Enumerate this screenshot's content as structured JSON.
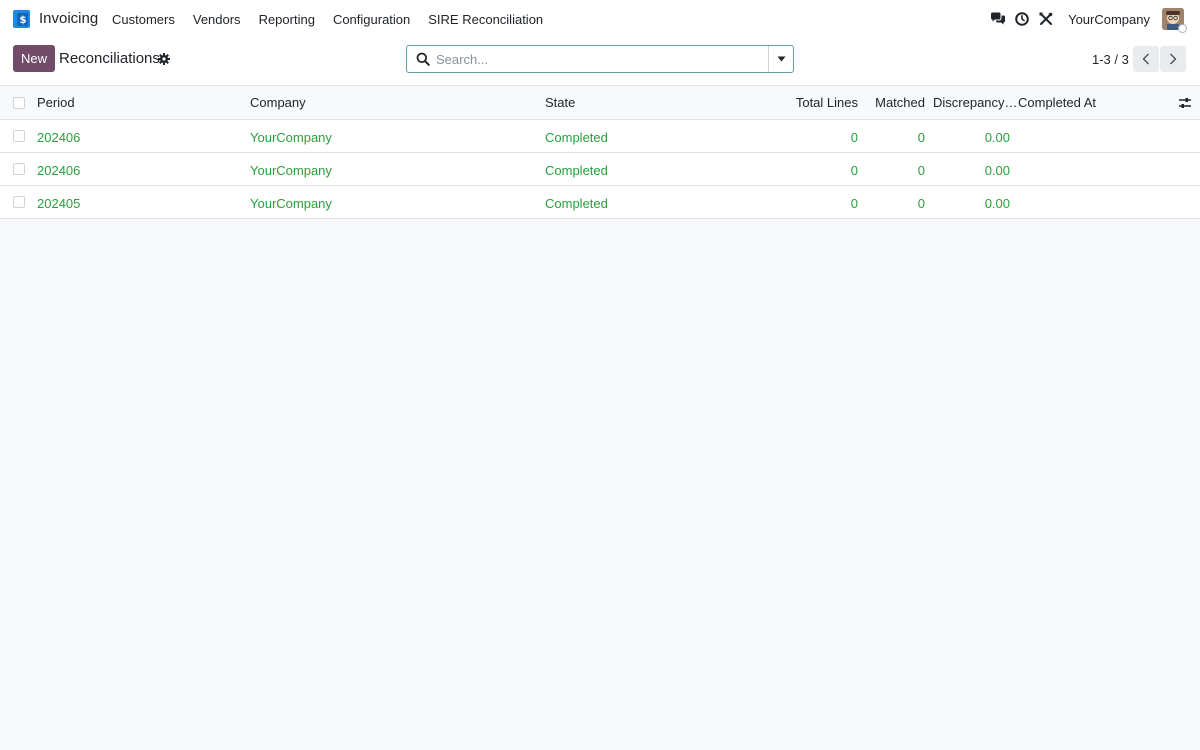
{
  "navbar": {
    "app_name": "Invoicing",
    "menu": [
      "Customers",
      "Vendors",
      "Reporting",
      "Configuration",
      "SIRE Reconciliation"
    ],
    "company": "YourCompany",
    "icons": [
      "chat-icon",
      "clock-icon",
      "tools-icon"
    ]
  },
  "control_panel": {
    "new_label": "New",
    "title": "Reconciliations",
    "search_placeholder": "Search...",
    "pager": "1-3 / 3"
  },
  "list": {
    "columns": {
      "period": "Period",
      "company": "Company",
      "state": "State",
      "total_lines": "Total Lines",
      "matched": "Matched",
      "discrepancy": "Discrepancy…",
      "completed_at": "Completed At"
    },
    "rows": [
      {
        "period": "202406",
        "company": "YourCompany",
        "state": "Completed",
        "total_lines": "0",
        "matched": "0",
        "discrepancy": "0.00",
        "completed_at": ""
      },
      {
        "period": "202406",
        "company": "YourCompany",
        "state": "Completed",
        "total_lines": "0",
        "matched": "0",
        "discrepancy": "0.00",
        "completed_at": ""
      },
      {
        "period": "202405",
        "company": "YourCompany",
        "state": "Completed",
        "total_lines": "0",
        "matched": "0",
        "discrepancy": "0.00",
        "completed_at": ""
      }
    ]
  },
  "colors": {
    "brand": "#714b67",
    "row_text": "#28a03c",
    "search_border": "#5f9e9e"
  }
}
